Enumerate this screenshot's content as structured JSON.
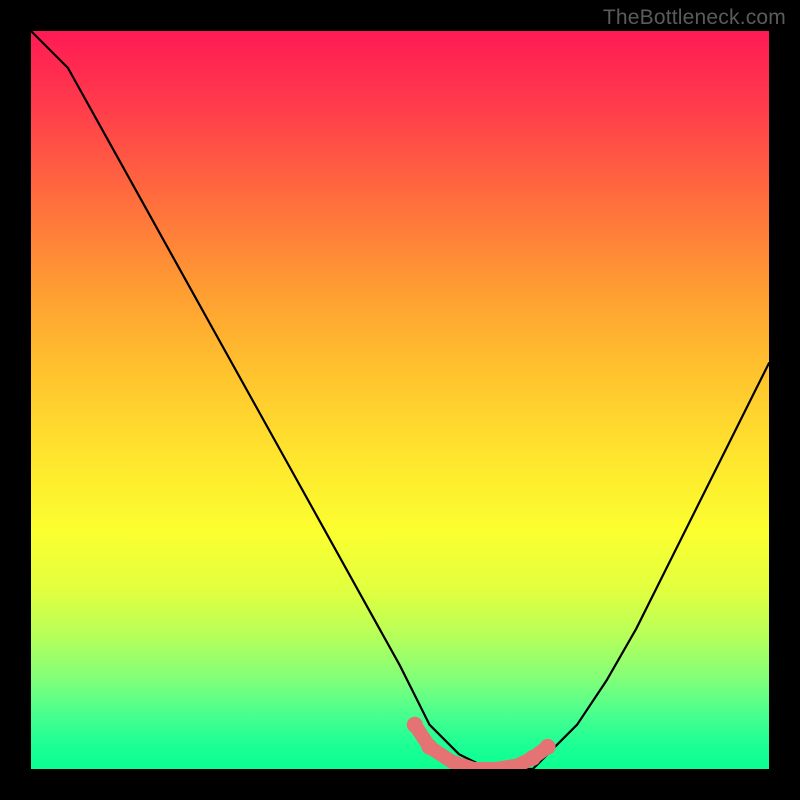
{
  "watermark": "TheBottleneck.com",
  "colors": {
    "frame": "#000000",
    "curve": "#000000",
    "marker": "#e57373"
  },
  "chart_data": {
    "type": "line",
    "title": "",
    "xlabel": "",
    "ylabel": "",
    "xlim": [
      0,
      100
    ],
    "ylim": [
      0,
      100
    ],
    "series": [
      {
        "name": "curve",
        "x": [
          0,
          5,
          10,
          15,
          20,
          25,
          30,
          35,
          40,
          45,
          50,
          52,
          54,
          58,
          62,
          66,
          68,
          70,
          74,
          78,
          82,
          86,
          90,
          94,
          98,
          100
        ],
        "y": [
          100,
          95,
          86,
          77,
          68,
          59,
          50,
          41,
          32,
          23,
          14,
          10,
          6,
          2,
          0,
          0,
          0,
          2,
          6,
          12,
          19,
          27,
          35,
          43,
          51,
          55
        ]
      }
    ],
    "markers": {
      "name": "bottom-markers",
      "x": [
        52,
        54,
        57,
        60,
        63,
        66,
        68,
        70
      ],
      "y": [
        6,
        3,
        1,
        0,
        0,
        0.5,
        1.5,
        3
      ]
    }
  }
}
